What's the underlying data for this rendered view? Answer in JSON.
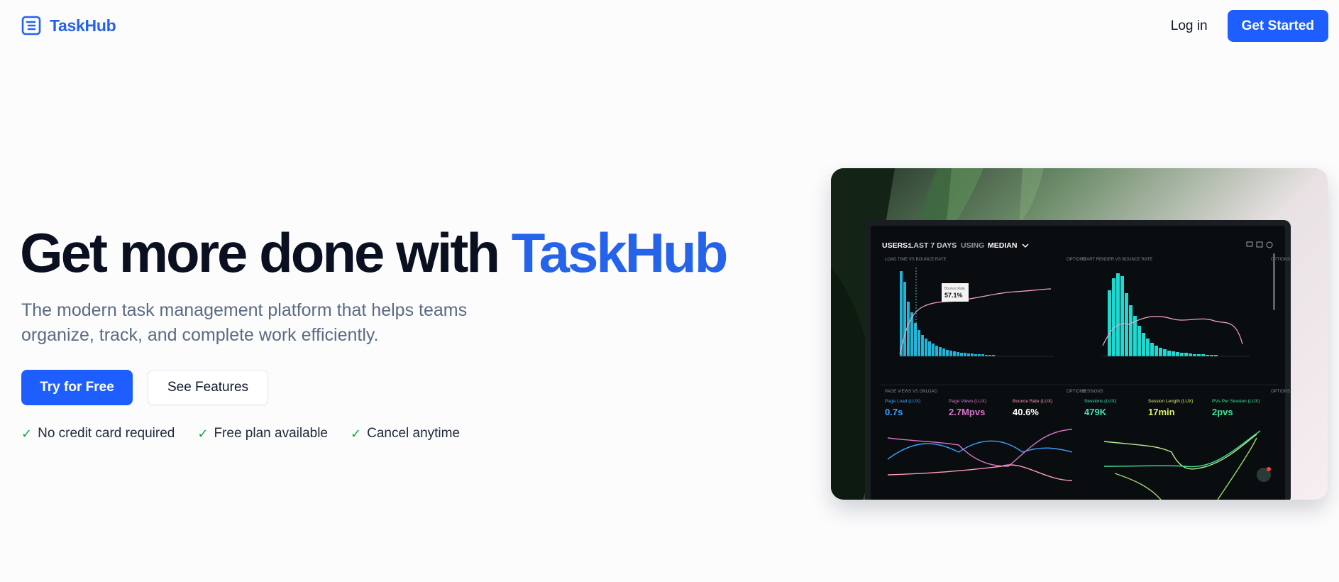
{
  "header": {
    "brand_name": "TaskHub",
    "login_label": "Log in",
    "get_started_label": "Get Started"
  },
  "hero": {
    "title_prefix": "Get more done with ",
    "title_accent": "TaskHub",
    "subtitle": "The modern task management platform that helps teams organize, track, and complete work efficiently.",
    "primary_cta": "Try for Free",
    "secondary_cta": "See Features",
    "features": [
      "No credit card required",
      "Free plan available",
      "Cancel anytime"
    ]
  },
  "dashboard": {
    "heading_prefix": "USERS:",
    "heading_range": "LAST 7 DAYS",
    "heading_using": "USING",
    "heading_metric": "MEDIAN",
    "panel1_title": "LOAD TIME VS BOUNCE RATE",
    "panel2_title": "START RENDER VS BOUNCE RATE",
    "panel3_title": "PAGE VIEWS VS ONLOAD",
    "panel4_title": "SESSIONS",
    "options_label": "OPTIONS",
    "tooltip_label": "Bounce Rate",
    "tooltip_value": "57.1%",
    "stat1_label": "Page Load (LUX)",
    "stat1_value": "0.7s",
    "stat2_label": "Page Views (LUX)",
    "stat2_value": "2.7Mpvs",
    "stat3_label": "Bounce Rate (LUX)",
    "stat3_value": "40.6%",
    "stat4_label": "Sessions (LUX)",
    "stat4_value": "479K",
    "stat5_label": "Session Length (LUX)",
    "stat5_value": "17min",
    "stat6_label": "PVs Per Session (LUX)",
    "stat6_value": "2pvs"
  },
  "colors": {
    "brand": "#2563eb",
    "button": "#1e5eff",
    "check": "#16a34a"
  }
}
